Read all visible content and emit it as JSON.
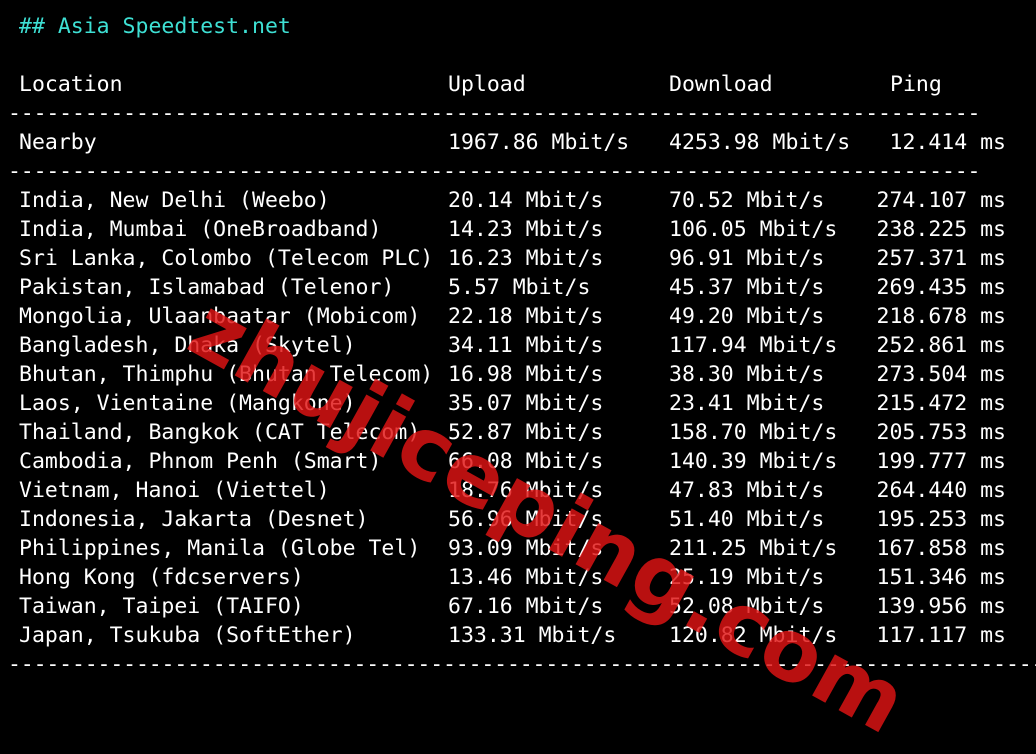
{
  "terminal": {
    "heading": "## Asia Speedtest.net",
    "headers": {
      "location": "Location",
      "upload": "Upload",
      "download": "Download",
      "ping": "Ping"
    },
    "separator": "-------------------------------------------------------------------------------------------",
    "nearby": {
      "location": "Nearby",
      "upload": "1967.86 Mbit/s",
      "download": "4253.98 Mbit/s",
      "ping": "12.414 ms"
    },
    "rows": [
      {
        "location": "India, New Delhi (Weebo)",
        "upload": "20.14 Mbit/s",
        "download": "70.52 Mbit/s",
        "ping": "274.107 ms"
      },
      {
        "location": "India, Mumbai (OneBroadband)",
        "upload": "14.23 Mbit/s",
        "download": "106.05 Mbit/s",
        "ping": "238.225 ms"
      },
      {
        "location": "Sri Lanka, Colombo (Telecom PLC)",
        "upload": "16.23 Mbit/s",
        "download": "96.91 Mbit/s",
        "ping": "257.371 ms"
      },
      {
        "location": "Pakistan, Islamabad (Telenor)",
        "upload": "5.57 Mbit/s",
        "download": "45.37 Mbit/s",
        "ping": "269.435 ms"
      },
      {
        "location": "Mongolia, Ulaanbaatar (Mobicom)",
        "upload": "22.18 Mbit/s",
        "download": "49.20 Mbit/s",
        "ping": "218.678 ms"
      },
      {
        "location": "Bangladesh, Dhaka (Skytel)",
        "upload": "34.11 Mbit/s",
        "download": "117.94 Mbit/s",
        "ping": "252.861 ms"
      },
      {
        "location": "Bhutan, Thimphu (Bhutan Telecom)",
        "upload": "16.98 Mbit/s",
        "download": "38.30 Mbit/s",
        "ping": "273.504 ms"
      },
      {
        "location": "Laos, Vientaine (Mangkone)",
        "upload": "35.07 Mbit/s",
        "download": "23.41 Mbit/s",
        "ping": "215.472 ms"
      },
      {
        "location": "Thailand, Bangkok (CAT Telecom)",
        "upload": "52.87 Mbit/s",
        "download": "158.70 Mbit/s",
        "ping": "205.753 ms"
      },
      {
        "location": "Cambodia, Phnom Penh (Smart)",
        "upload": "66.08 Mbit/s",
        "download": "140.39 Mbit/s",
        "ping": "199.777 ms"
      },
      {
        "location": "Vietnam, Hanoi (Viettel)",
        "upload": "18.76 Mbit/s",
        "download": "47.83 Mbit/s",
        "ping": "264.440 ms"
      },
      {
        "location": "Indonesia, Jakarta (Desnet)",
        "upload": "56.96 Mbit/s",
        "download": "51.40 Mbit/s",
        "ping": "195.253 ms"
      },
      {
        "location": "Philippines, Manila (Globe Tel)",
        "upload": "93.09 Mbit/s",
        "download": "211.25 Mbit/s",
        "ping": "167.858 ms"
      },
      {
        "location": "Hong Kong (fdcservers)",
        "upload": "13.46 Mbit/s",
        "download": "25.19 Mbit/s",
        "ping": "151.346 ms"
      },
      {
        "location": "Taiwan, Taipei (TAIFO)",
        "upload": "67.16 Mbit/s",
        "download": "52.08 Mbit/s",
        "ping": "139.956 ms"
      },
      {
        "location": "Japan, Tsukuba (SoftEther)",
        "upload": "133.31 Mbit/s",
        "download": "120.82 Mbit/s",
        "ping": "117.117 ms"
      }
    ]
  },
  "watermark": "zhujiceping.com",
  "colors": {
    "background": "#000000",
    "text": "#ffffff",
    "heading": "#3ee0d4",
    "watermark": "#e11414"
  }
}
